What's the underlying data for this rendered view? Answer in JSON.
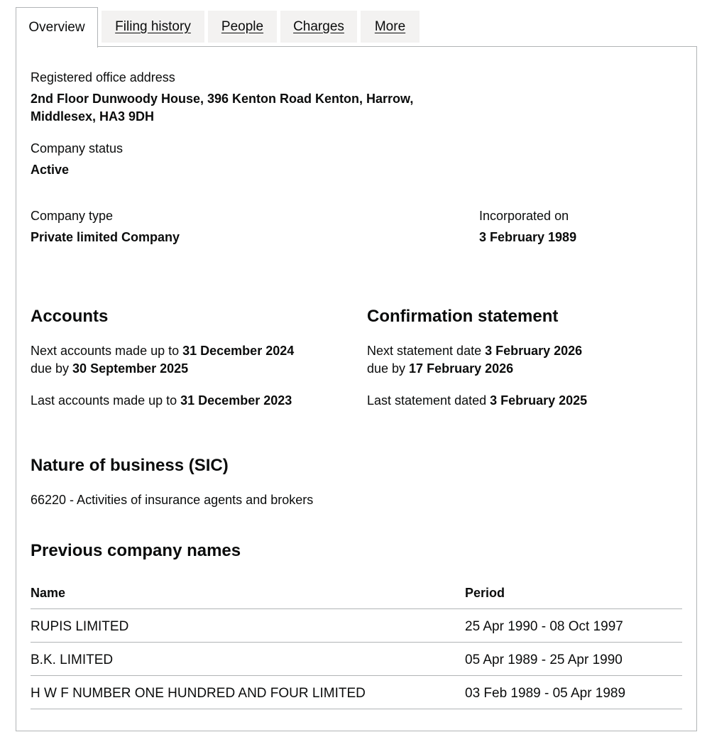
{
  "tabs": [
    {
      "label": "Overview",
      "active": true
    },
    {
      "label": "Filing history",
      "active": false
    },
    {
      "label": "People",
      "active": false
    },
    {
      "label": "Charges",
      "active": false
    },
    {
      "label": "More",
      "active": false
    }
  ],
  "registered_office": {
    "label": "Registered office address",
    "line1": "2nd Floor Dunwoody House, 396 Kenton Road Kenton, Harrow,",
    "line2": "Middlesex, HA3 9DH"
  },
  "company_status": {
    "label": "Company status",
    "value": "Active"
  },
  "company_type": {
    "label": "Company type",
    "value": "Private limited Company"
  },
  "incorporated": {
    "label": "Incorporated on",
    "value": "3 February 1989"
  },
  "accounts": {
    "heading": "Accounts",
    "next_prefix": "Next accounts made up to ",
    "next_date": "31 December 2024",
    "due_prefix": "due by ",
    "due_date": "30 September 2025",
    "last_prefix": "Last accounts made up to ",
    "last_date": "31 December 2023"
  },
  "confirmation": {
    "heading": "Confirmation statement",
    "next_prefix": "Next statement date ",
    "next_date": "3 February 2026",
    "due_prefix": "due by ",
    "due_date": "17 February 2026",
    "last_prefix": "Last statement dated ",
    "last_date": "3 February 2025"
  },
  "sic": {
    "heading": "Nature of business (SIC)",
    "entry": "66220 - Activities of insurance agents and brokers"
  },
  "previous_names": {
    "heading": "Previous company names",
    "columns": [
      "Name",
      "Period"
    ],
    "rows": [
      {
        "name": "RUPIS LIMITED",
        "period": "25 Apr 1990 - 08 Oct 1997"
      },
      {
        "name": "B.K. LIMITED",
        "period": "05 Apr 1989 - 25 Apr 1990"
      },
      {
        "name": "H W F NUMBER ONE HUNDRED AND FOUR LIMITED",
        "period": "03 Feb 1989 - 05 Apr 1989"
      }
    ]
  }
}
